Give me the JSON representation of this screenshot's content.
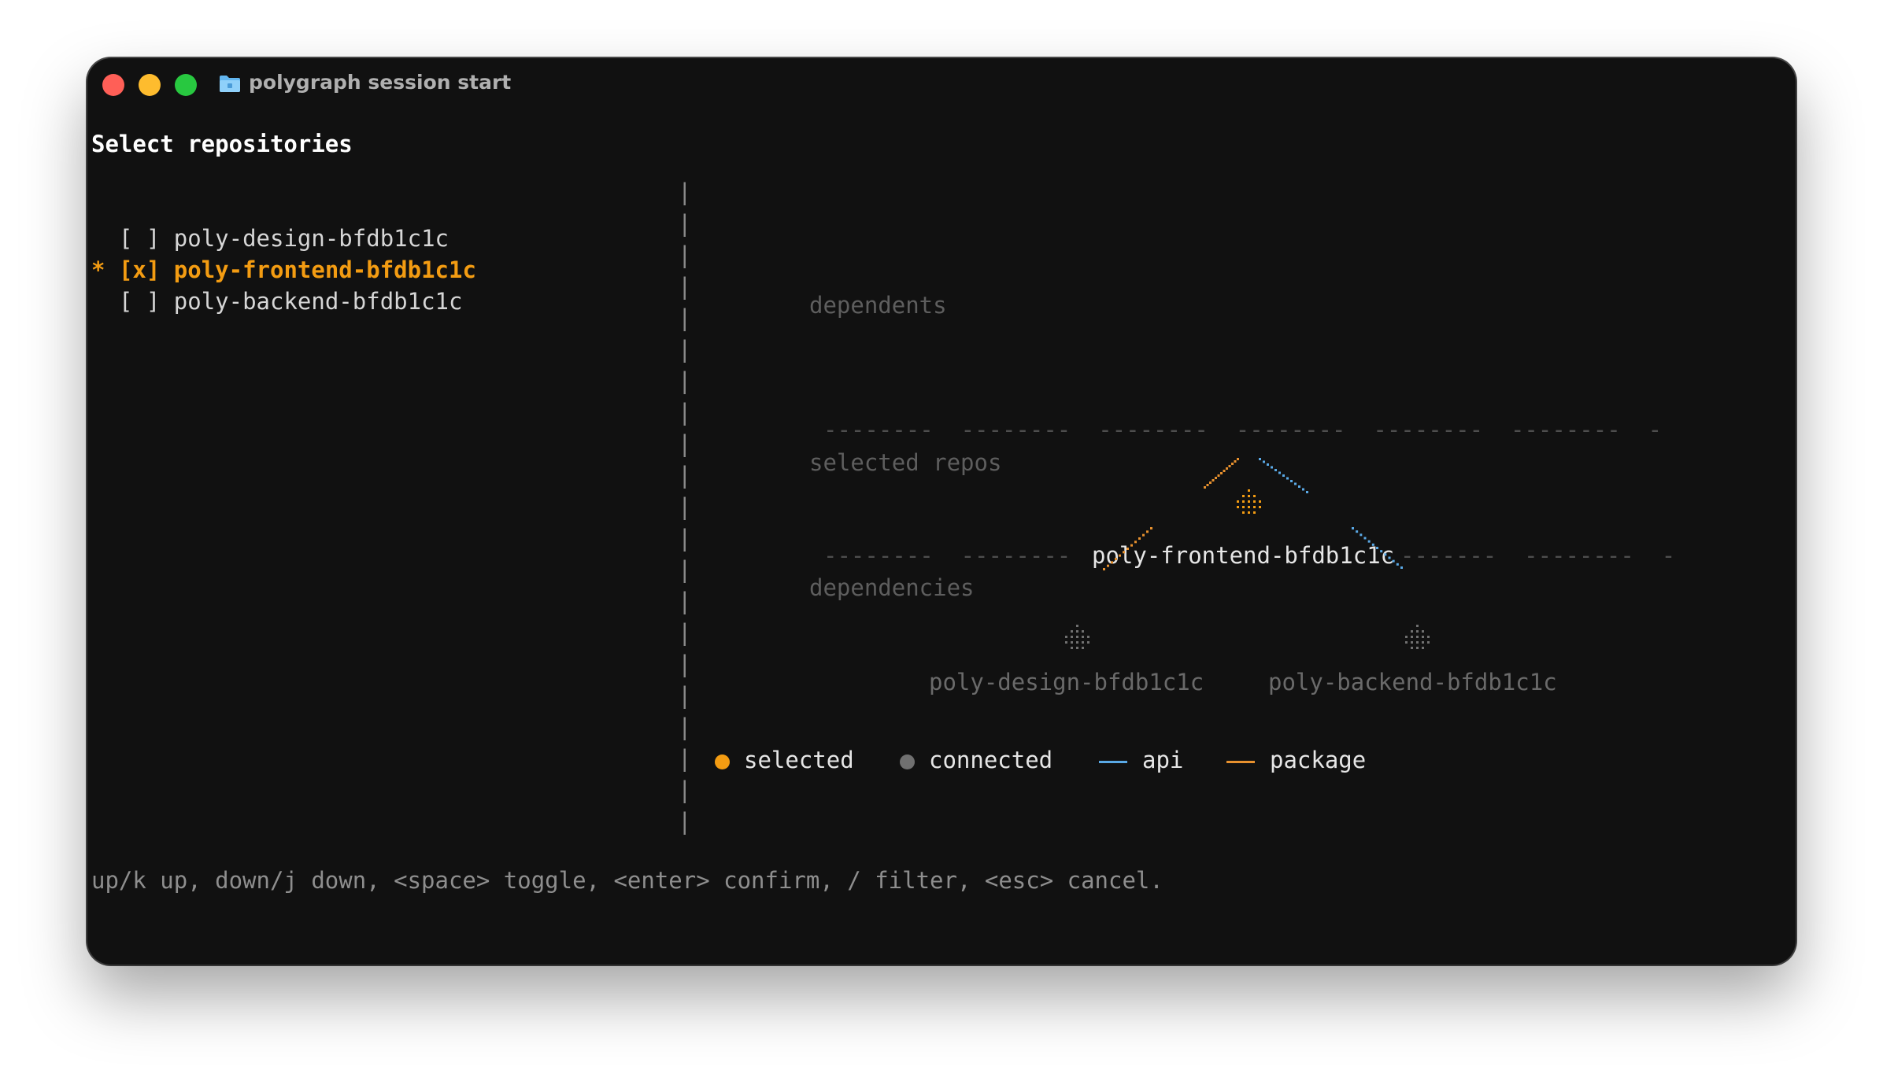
{
  "window": {
    "title": "polygraph session start"
  },
  "heading": "Select repositories",
  "repos": [
    {
      "cursor": " ",
      "checkbox": "[ ]",
      "name": "poly-design-bfdb1c1c",
      "selected": false
    },
    {
      "cursor": "*",
      "checkbox": "[x]",
      "name": "poly-frontend-bfdb1c1c",
      "selected": true
    },
    {
      "cursor": " ",
      "checkbox": "[ ]",
      "name": "poly-backend-bfdb1c1c",
      "selected": false
    }
  ],
  "graph": {
    "dependents_label": "dependents",
    "selected_label": "selected repos",
    "dependencies_label": "dependencies",
    "selected_node": "poly-frontend-bfdb1c1c",
    "dependency_nodes": [
      "poly-design-bfdb1c1c",
      "poly-backend-bfdb1c1c"
    ]
  },
  "legend": {
    "selected": "selected",
    "connected": "connected",
    "api": "api",
    "package": "package"
  },
  "colors": {
    "selected": "#f39c12",
    "connected": "#707070",
    "api": "#5aa9e6",
    "package": "#e8912e"
  },
  "help": "up/k up, down/j down, <space> toggle, <enter> confirm, / filter, <esc> cancel."
}
